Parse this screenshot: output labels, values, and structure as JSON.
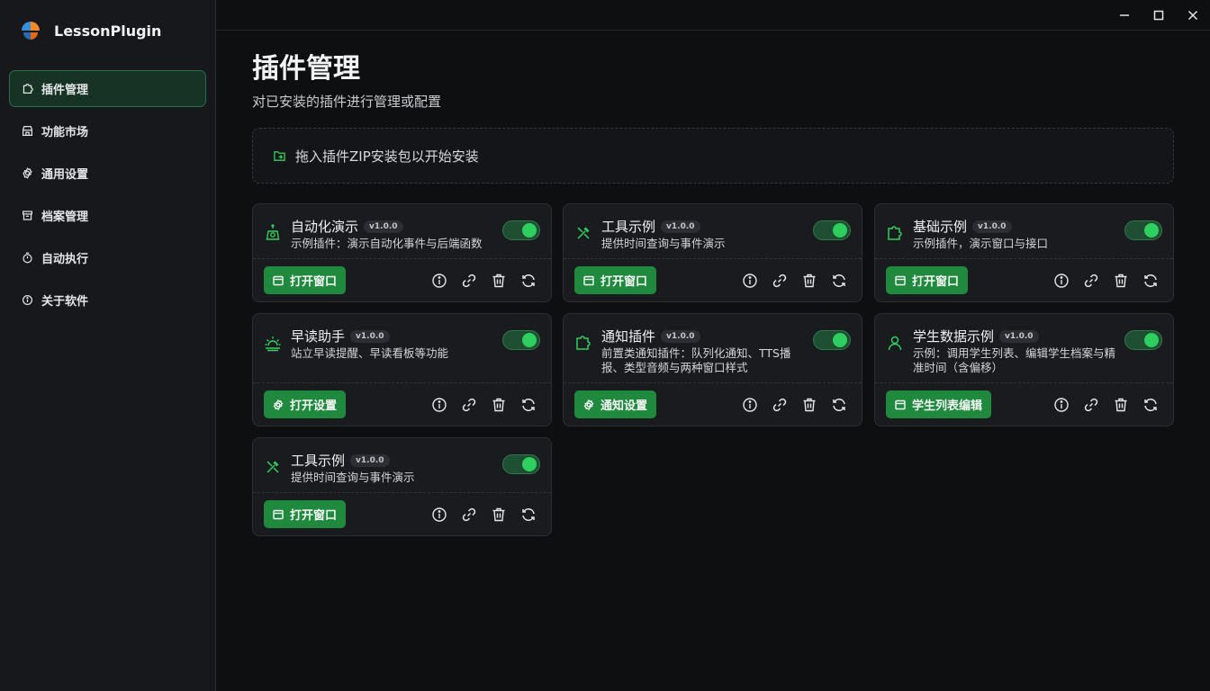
{
  "app": {
    "name": "LessonPlugin"
  },
  "colors": {
    "accent": "#1f8a3e",
    "accent_bright": "#2fcf5f",
    "bg": "#0e0f11",
    "sidebar": "#17181b"
  },
  "sidebar": {
    "items": [
      {
        "label": "插件管理",
        "icon": "puzzle-icon",
        "active": true
      },
      {
        "label": "功能市场",
        "icon": "store-icon"
      },
      {
        "label": "通用设置",
        "icon": "gear-icon"
      },
      {
        "label": "档案管理",
        "icon": "archive-icon"
      },
      {
        "label": "自动执行",
        "icon": "timer-icon"
      },
      {
        "label": "关于软件",
        "icon": "info-icon"
      }
    ]
  },
  "main": {
    "title": "插件管理",
    "subtitle": "对已安装的插件进行管理或配置",
    "dropzone": "拖入插件ZIP安装包以开始安装"
  },
  "plugins": [
    {
      "title": "自动化演示",
      "version": "v1.0.0",
      "desc": "示例插件：演示自动化事件与后端函数",
      "icon": "robot-icon",
      "enabled": true,
      "action": "打开窗口",
      "action_icon": "window-icon"
    },
    {
      "title": "工具示例",
      "version": "v1.0.0",
      "desc": "提供时间查询与事件演示",
      "icon": "tools-icon",
      "enabled": true,
      "action": "打开窗口",
      "action_icon": "window-icon"
    },
    {
      "title": "基础示例",
      "version": "v1.0.0",
      "desc": "示例插件，演示窗口与接口",
      "icon": "puzzle-icon",
      "enabled": true,
      "action": "打开窗口",
      "action_icon": "window-icon"
    },
    {
      "title": "早读助手",
      "version": "v1.0.0",
      "desc": "站立早读提醒、早读看板等功能",
      "icon": "sunrise-icon",
      "enabled": true,
      "action": "打开设置",
      "action_icon": "gear-icon"
    },
    {
      "title": "通知插件",
      "version": "v1.0.0",
      "desc": "前置类通知插件：队列化通知、TTS播报、类型音频与两种窗口样式",
      "icon": "puzzle-icon",
      "enabled": true,
      "action": "通知设置",
      "action_icon": "gear-icon"
    },
    {
      "title": "学生数据示例",
      "version": "v1.0.0",
      "desc": "示例：调用学生列表、编辑学生档案与精准时间（含偏移）",
      "icon": "user-icon",
      "enabled": true,
      "action": "学生列表编辑",
      "action_icon": "window-icon"
    },
    {
      "title": "工具示例",
      "version": "v1.0.0",
      "desc": "提供时间查询与事件演示",
      "icon": "tools-icon",
      "enabled": true,
      "action": "打开窗口",
      "action_icon": "window-icon"
    }
  ]
}
